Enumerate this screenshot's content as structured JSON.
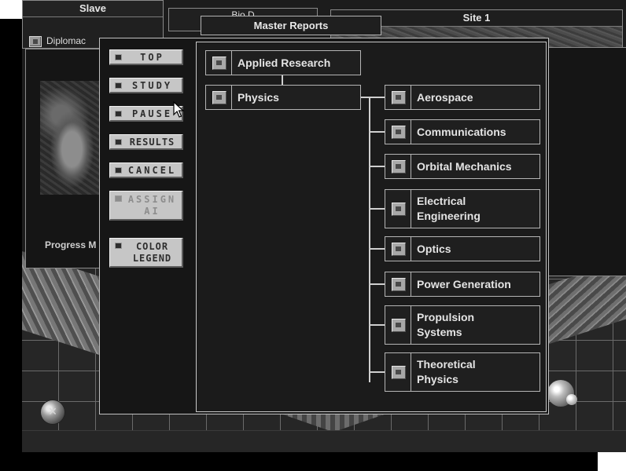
{
  "background_windows": {
    "slave": {
      "title": "Slave",
      "diplomacy_label": "Diplomac"
    },
    "bio": {
      "title": "Bio D"
    },
    "site": {
      "title": "Site 1"
    },
    "progress": {
      "label": "Progress M"
    }
  },
  "master_reports": {
    "title": "Master Reports",
    "buttons": {
      "top": "TOP",
      "study": "STUDY",
      "pause": "PAUSE",
      "results": "RESULTS",
      "cancel": "CANCEL",
      "assign": "ASSIGN\nAI",
      "legend": "COLOR\nLEGEND"
    },
    "tree": {
      "root": "Applied Research",
      "branch": "Physics",
      "leaves": [
        "Aerospace",
        "Communications",
        "Orbital Mechanics",
        "Electrical Engineering",
        "Optics",
        "Power Generation",
        "Propulsion Systems",
        "Theoretical Physics"
      ]
    }
  }
}
